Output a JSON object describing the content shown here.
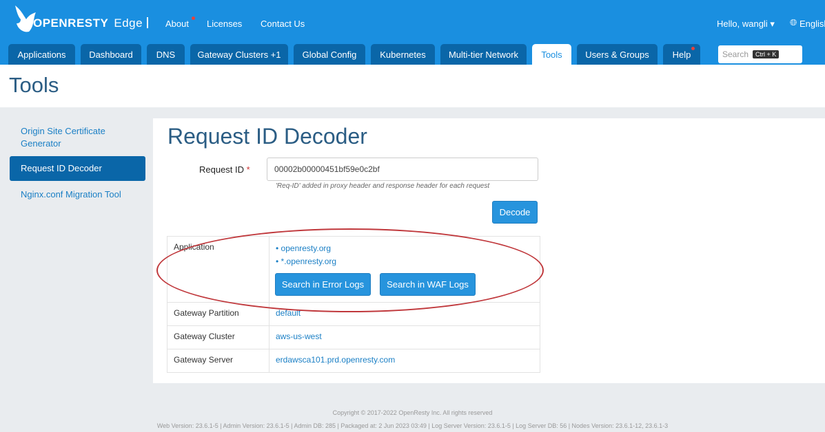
{
  "header": {
    "brand": "OPENRESTY",
    "product": "Edge",
    "links": {
      "about": "About",
      "licenses": "Licenses",
      "contact": "Contact Us"
    },
    "user_greeting": "Hello, wangli",
    "language": "English"
  },
  "nav": {
    "tabs": [
      "Applications",
      "Dashboard",
      "DNS",
      "Gateway Clusters +1",
      "Global Config",
      "Kubernetes",
      "Multi-tier Network",
      "Tools",
      "Users & Groups",
      "Help"
    ],
    "active": "Tools",
    "search_placeholder": "Search",
    "search_shortcut": "Ctrl + K"
  },
  "page": {
    "title": "Tools"
  },
  "sidebar": {
    "items": [
      "Origin Site Certificate Generator",
      "Request ID Decoder",
      "Nginx.conf Migration Tool"
    ],
    "active_index": 1
  },
  "decoder": {
    "heading": "Request ID Decoder",
    "field_label": "Request ID",
    "field_required_mark": "*",
    "field_value": "00002b00000451bf59e0c2bf",
    "hint": "'Req-ID' added in proxy header and response header for each request",
    "decode_button": "Decode"
  },
  "results": {
    "application_label": "Application",
    "applications": [
      "openresty.org",
      "*.openresty.org"
    ],
    "error_logs_button": "Search in Error Logs",
    "waf_logs_button": "Search in WAF Logs",
    "partition_label": "Gateway Partition",
    "partition_value": "default",
    "cluster_label": "Gateway Cluster",
    "cluster_value": "aws-us-west",
    "server_label": "Gateway Server",
    "server_value": "erdawsca101.prd.openresty.com"
  },
  "footer": {
    "copyright": "Copyright © 2017-2022 OpenResty Inc. All rights reserved",
    "versions": "Web Version: 23.6.1-5 | Admin Version: 23.6.1-5 | Admin DB: 285 | Packaged at: 2 Jun 2023 03:49 | Log Server Version: 23.6.1-5 | Log Server DB: 56 | Nodes Version: 23.6.1-12, 23.6.1-3"
  },
  "colors": {
    "brand_blue": "#1a8fe0",
    "nav_tab": "#0a66a8",
    "heading": "#2b5d84",
    "annotation": "#c0383c"
  }
}
